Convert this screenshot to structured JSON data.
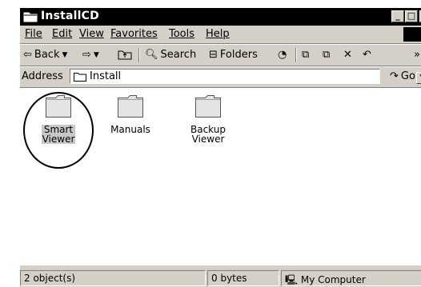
{
  "window": {
    "title": "InstallCD"
  },
  "menu": [
    "File",
    "Edit",
    "View",
    "Favorites",
    "Tools",
    "Help"
  ],
  "toolbar": {
    "back": "Back",
    "search": "Search",
    "folders": "Folders"
  },
  "address": {
    "label": "Address",
    "value": "Install",
    "go": "Go"
  },
  "files": [
    {
      "name_line1": "Smart",
      "name_line2": "Viewer",
      "selected": true,
      "icon": "folder-icon"
    },
    {
      "name_line1": "Manuals",
      "name_line2": "",
      "selected": false,
      "icon": "folder-icon"
    },
    {
      "name_line1": "Backup Viewer",
      "name_line2": "",
      "selected": false,
      "icon": "folder-icon"
    }
  ],
  "status": {
    "objects": "2 object(s)",
    "size": "0 bytes",
    "zone": "My Computer"
  }
}
